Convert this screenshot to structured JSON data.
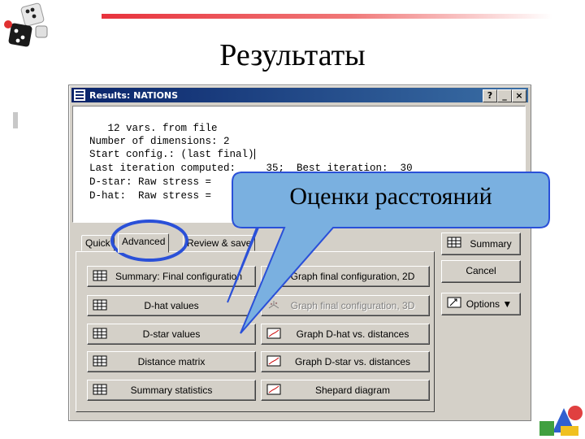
{
  "slide": {
    "title": "Результаты"
  },
  "window": {
    "title": "Results: NATIONS",
    "help_button": "?",
    "minimize_button": "_",
    "close_button": "×"
  },
  "output_lines": [
    "   12 vars. from file",
    "Number of dimensions: 2",
    "Start config.: (last final)",
    "Last iteration computed:     35;  Best iteration:  30",
    "D-star: Raw stress =",
    "D-hat:  Raw stress ="
  ],
  "tabs": [
    "Quick",
    "Advanced",
    "Review & save"
  ],
  "buttons_left": [
    "Summary: Final configuration",
    "D-hat values",
    "D-star values",
    "Distance matrix",
    "Summary statistics"
  ],
  "buttons_right": [
    "Graph final configuration, 2D",
    "Graph final configuration, 3D",
    "Graph D-hat vs. distances",
    "Graph D-star vs. distances",
    "Shepard diagram"
  ],
  "side_buttons": {
    "summary": "Summary",
    "cancel": "Cancel",
    "options": "Options ▼"
  },
  "callout": {
    "text": "Оценки расстояний"
  },
  "colors": {
    "titlebar": "#0a246a",
    "callout_fill": "#7ab0e0",
    "highlight_ring": "#2a50d8",
    "accent_rule": "#e8323c"
  }
}
